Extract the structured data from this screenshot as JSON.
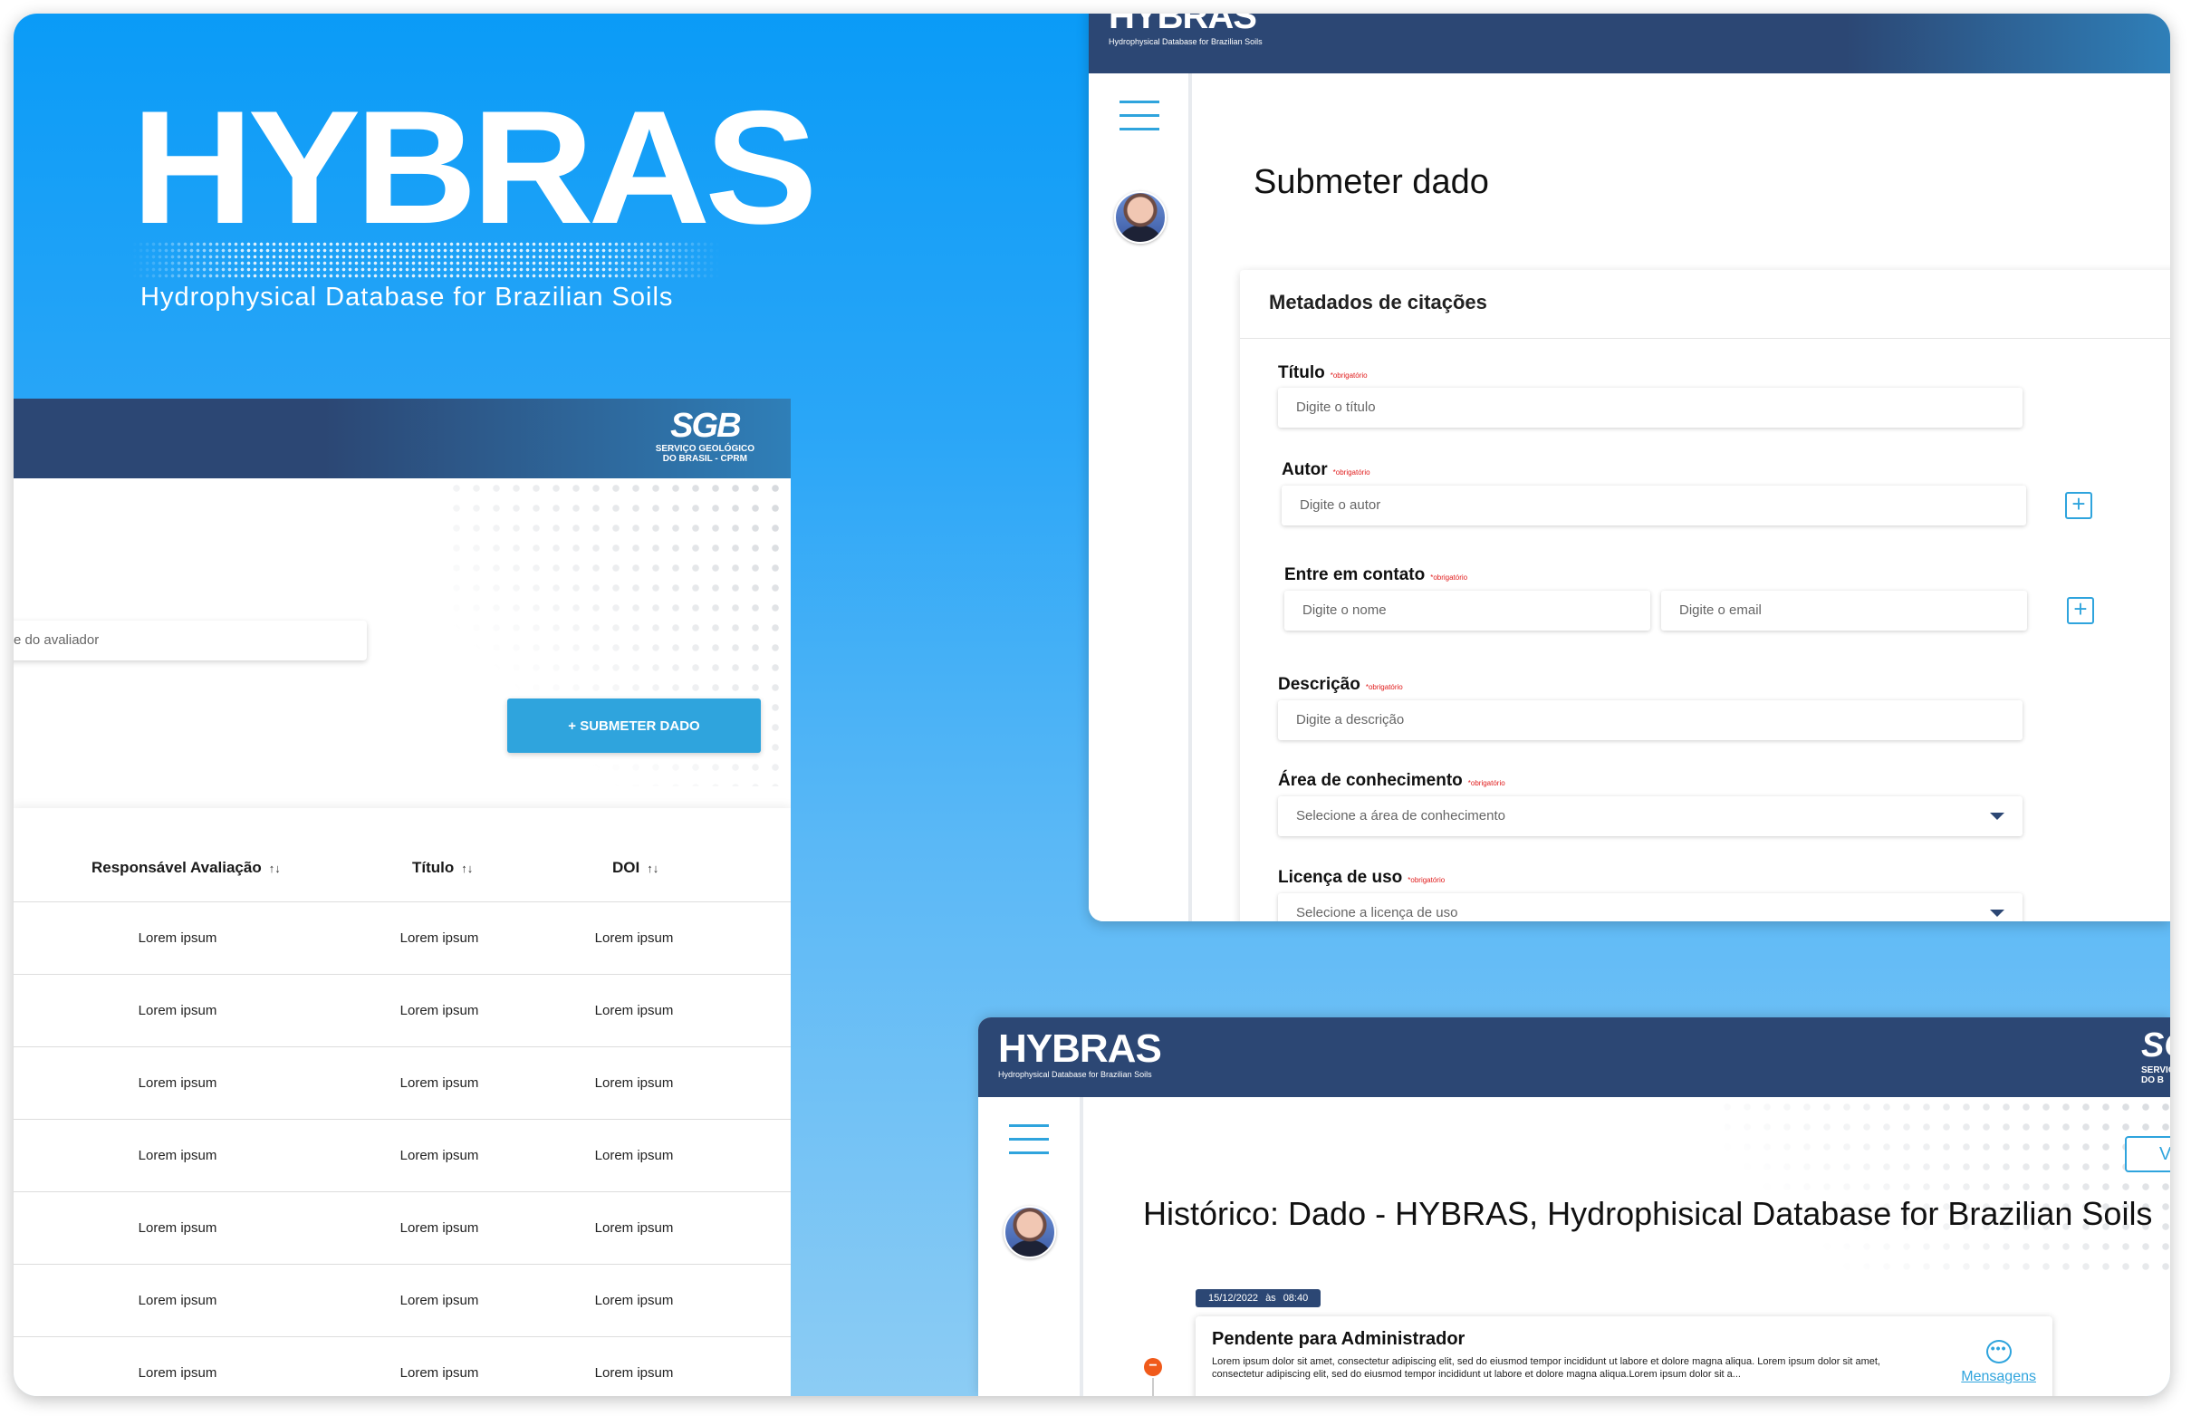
{
  "hero": {
    "logo": "HYBRAS",
    "tagline": "Hydrophysical Database for Brazilian Soils"
  },
  "list_panel": {
    "sgb_logo": "SGB",
    "sgb_subtitle_1": "SERVIÇO GEOLÓGICO",
    "sgb_subtitle_2": "DO BRASIL - CPRM",
    "search_placeholder": "e do avaliador",
    "submit_button": "+ SUBMETER DADO",
    "columns": [
      "Responsável Avaliação",
      "Título",
      "DOI"
    ],
    "sort_icon": "↑↓",
    "rows": [
      [
        "Lorem ipsum",
        "Lorem ipsum",
        "Lorem ipsum"
      ],
      [
        "Lorem ipsum",
        "Lorem ipsum",
        "Lorem ipsum"
      ],
      [
        "Lorem ipsum",
        "Lorem ipsum",
        "Lorem ipsum"
      ],
      [
        "Lorem ipsum",
        "Lorem ipsum",
        "Lorem ipsum"
      ],
      [
        "Lorem ipsum",
        "Lorem ipsum",
        "Lorem ipsum"
      ],
      [
        "Lorem ipsum",
        "Lorem ipsum",
        "Lorem ipsum"
      ],
      [
        "Lorem ipsum",
        "Lorem ipsum",
        "Lorem ipsum"
      ]
    ]
  },
  "form_panel": {
    "logo": "HYBRAS",
    "logo_sub": "Hydrophysical Database for Brazilian Soils",
    "page_title": "Submeter dado",
    "card_title": "Metadados de citações",
    "required_tag": "*obrigatório",
    "fields": {
      "titulo": {
        "label": "Título",
        "placeholder": "Digite o título"
      },
      "autor": {
        "label": "Autor",
        "placeholder": "Digite o autor"
      },
      "contato": {
        "label": "Entre em contato",
        "placeholder_name": "Digite o nome",
        "placeholder_email": "Digite o email"
      },
      "descricao": {
        "label": "Descrição",
        "placeholder": "Digite a descrição"
      },
      "area": {
        "label": "Área de conhecimento",
        "placeholder": "Selecione a área de conhecimento"
      },
      "licenca": {
        "label": "Licença de uso",
        "placeholder": "Selecione a licença de uso"
      }
    },
    "plus": "+"
  },
  "history_panel": {
    "logo": "HYBRAS",
    "logo_sub": "Hydrophysical Database for Brazilian Soils",
    "sgb_partial": "SG",
    "sgb_partial_sub1": "SERVIÇO",
    "sgb_partial_sub2": "DO B",
    "corner_button": "V",
    "title": "Histórico: Dado - HYBRAS, Hydrophisical Database for Brazilian Soils",
    "date": "15/12/2022",
    "at": "às",
    "time": "08:40",
    "timeline_icon": "−",
    "entry_title": "Pendente para Administrador",
    "entry_text": "Lorem ipsum dolor sit amet, consectetur adipiscing elit, sed do eiusmod tempor incididunt ut labore et dolore magna aliqua. Lorem ipsum dolor sit amet, consectetur adipiscing elit, sed do eiusmod tempor incididunt ut labore et dolore magna aliqua.Lorem ipsum dolor sit a...",
    "messages_icon": "•••",
    "messages_label": "Mensagens"
  },
  "colors": {
    "header_navy": "#2c4774",
    "accent_blue": "#2fa4dd",
    "background_blue": "#0a9bf7",
    "required_red": "#e01b1b"
  }
}
